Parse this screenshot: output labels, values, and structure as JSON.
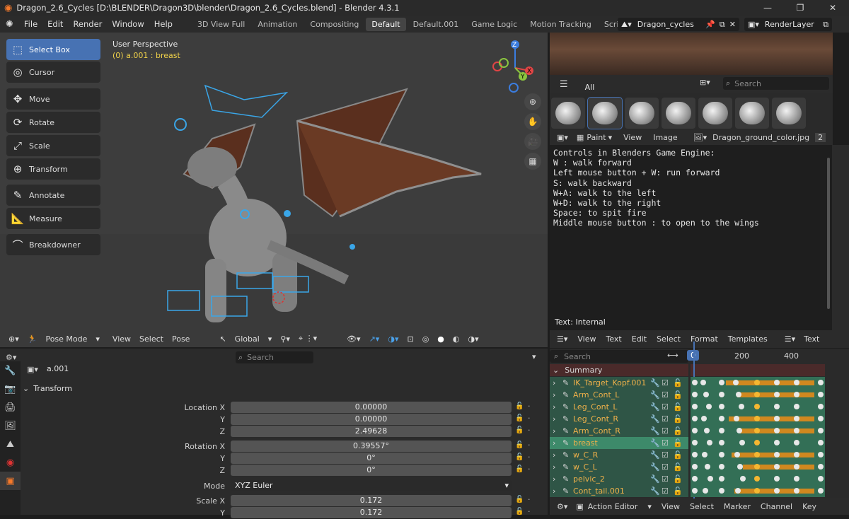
{
  "window": {
    "title": "Dragon_2.6_Cycles [D:\\BLENDER\\Dragon3D\\blender\\Dragon_2.6_Cycles.blend] - Blender 4.3.1"
  },
  "menu": [
    "File",
    "Edit",
    "Render",
    "Window",
    "Help"
  ],
  "workspaces": [
    "3D View Full",
    "Animation",
    "Compositing",
    "Default",
    "Default.001",
    "Game Logic",
    "Motion Tracking",
    "Scripting"
  ],
  "active_workspace": "Default",
  "scene": {
    "name": "Dragon_cycles",
    "layer": "RenderLayer"
  },
  "viewport": {
    "perspective": "User Perspective",
    "selection": "(0) a.001 : breast",
    "tools": [
      "Select Box",
      "Cursor",
      "Move",
      "Rotate",
      "Scale",
      "Transform",
      "Annotate",
      "Measure",
      "Breakdowner"
    ],
    "header": {
      "mode": "Pose Mode",
      "menus": [
        "View",
        "Select",
        "Pose"
      ],
      "orientation": "Global"
    },
    "gizmo_axes": [
      "X",
      "Y",
      "Z"
    ]
  },
  "properties": {
    "search_placeholder": "Search",
    "object": "a.001",
    "panel": "Transform",
    "rows": [
      {
        "label": "Location X",
        "value": "0.00000"
      },
      {
        "label": "Y",
        "value": "0.00000"
      },
      {
        "label": "Z",
        "value": "2.49628"
      },
      {
        "label": "Rotation X",
        "value": "0.39557°"
      },
      {
        "label": "Y",
        "value": "0°"
      },
      {
        "label": "Z",
        "value": "0°"
      },
      {
        "label": "Mode",
        "value": "XYZ Euler"
      },
      {
        "label": "Scale X",
        "value": "0.172"
      },
      {
        "label": "Y",
        "value": "0.172"
      }
    ]
  },
  "image_editor": {
    "tab": "All",
    "search_placeholder": "Search",
    "header": {
      "mode": "Paint",
      "menus": [
        "View",
        "Image"
      ],
      "image": "Dragon_ground_color.jpg",
      "users": "2"
    }
  },
  "text_editor": {
    "lines": [
      "Controls in Blenders Game Engine:",
      "W : walk forward",
      "Left mouse button + W: run forward",
      "S: walk backward",
      "W+A: walk to the left",
      "W+D: walk to the right",
      "Space: to spit fire",
      "Middle mouse button : to open to the wings"
    ],
    "status": "Text: Internal",
    "menus": [
      "View",
      "Text",
      "Edit",
      "Select",
      "Format",
      "Templates"
    ],
    "datablock": "Text"
  },
  "action_editor": {
    "search_placeholder": "Search",
    "frames": [
      "0",
      "200",
      "400"
    ],
    "summary": "Summary",
    "channels": [
      "IK_Target_Kopf.001",
      "Arm_Cont_L",
      "Leg_Cont_L",
      "Leg_Cont_R",
      "Arm_Cont_R",
      "breast",
      "w_C_R",
      "w_C_L",
      "pelvic_2",
      "Cont_tail.001"
    ],
    "selected_channel": "breast",
    "footer": {
      "editor": "Action Editor",
      "menus": [
        "View",
        "Select",
        "Marker",
        "Channel",
        "Key"
      ]
    }
  },
  "colors": {
    "accent": "#4772b3",
    "channel_bg": "#2f5546",
    "channel_name": "#f0b14a",
    "bone_blue": "#3aa6e8"
  }
}
